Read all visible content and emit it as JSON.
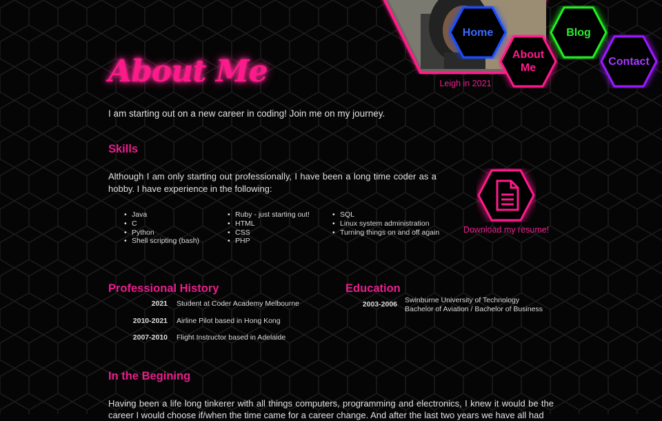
{
  "page": {
    "title": "About Me",
    "intro": "I am starting out on a new career in coding! Join me on my journey."
  },
  "photo": {
    "caption": "Leigh in 2021"
  },
  "nav": [
    {
      "label": "Home",
      "color": "#1a4dff"
    },
    {
      "label": "About Me",
      "color": "#ff1a8c"
    },
    {
      "label": "Blog",
      "color": "#22ee22"
    },
    {
      "label": "Contact",
      "color": "#9b1aff"
    }
  ],
  "skills": {
    "heading": "Skills",
    "paragraph": "Although I am only starting out professionally, I have been a long time coder as a hobby. I have experience in the following:",
    "columns": [
      [
        "Java",
        "C",
        "Python",
        "Shell scripting (bash)"
      ],
      [
        "Ruby - just starting out!",
        "HTML",
        "CSS",
        "PHP"
      ],
      [
        "SQL",
        "Linux system administration",
        "Turning things on and off again"
      ]
    ],
    "resume_icon": "document-icon",
    "resume_label": "Download my resume!"
  },
  "history": {
    "heading": "Professional History",
    "items": [
      {
        "year": "2021",
        "desc": "Student at Coder Academy Melbourne"
      },
      {
        "year": "2010-2021",
        "desc": "Airline Pilot based in Hong Kong"
      },
      {
        "year": "2007-2010",
        "desc": "Flight Instructor based in Adelaide"
      }
    ]
  },
  "education": {
    "heading": "Education",
    "items": [
      {
        "year": "2003-2006",
        "line1": "Swinburne University of Technology",
        "line2": "Bachelor of Aviation / Bachelor of Business"
      }
    ]
  },
  "beginning": {
    "heading": "In the Begining",
    "paragraph": "Having been a life long tinkerer with all things computers, programming and electronics, I knew it would be the career I would choose if/when the time came for a career change. And after the last two years we have all had"
  },
  "colors": {
    "accent": "#e91e8c",
    "background": "#050505",
    "text": "#d8d8d8"
  }
}
